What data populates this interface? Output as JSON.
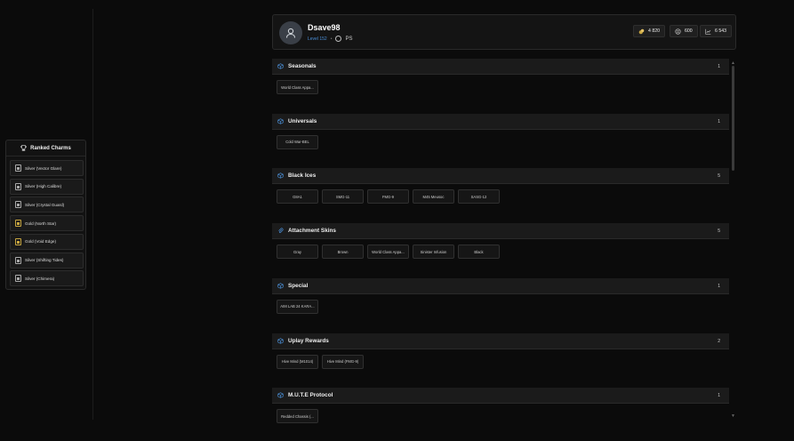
{
  "charms": {
    "title": "Ranked Charms",
    "items": [
      {
        "label": "Silver (Vector Glare)",
        "tier": "silver"
      },
      {
        "label": "Silver (High Calibre)",
        "tier": "silver"
      },
      {
        "label": "Silver (Crystal Guard)",
        "tier": "silver"
      },
      {
        "label": "Gold (North Star)",
        "tier": "gold"
      },
      {
        "label": "Gold (Void Edge)",
        "tier": "gold"
      },
      {
        "label": "Silver (Shifting Tides)",
        "tier": "silver"
      },
      {
        "label": "Silver (Chimera)",
        "tier": "silver"
      }
    ]
  },
  "profile": {
    "username": "Dsave98",
    "level": "Level 152",
    "separator": "•",
    "platform": "PS",
    "stats": [
      {
        "icon": "gold-coin-icon",
        "value": "4 820"
      },
      {
        "icon": "silver-coin-icon",
        "value": "600"
      },
      {
        "icon": "chart-icon",
        "value": "6 543"
      }
    ]
  },
  "sections": [
    {
      "title": "Seasonals",
      "count": "1",
      "items": [
        "World Class Appa..."
      ]
    },
    {
      "title": "Universals",
      "count": "1",
      "items": [
        "Cold War-BEL"
      ]
    },
    {
      "title": "Black Ices",
      "count": "5",
      "items": [
        "G8A1",
        "SMG-11",
        "FMG-9",
        "M45 Meusoc",
        "SASG-12"
      ]
    },
    {
      "title": "Attachment Skins",
      "count": "5",
      "items": [
        "Gray",
        "Brown",
        "World Class Appa...",
        "Sinister Infusion",
        "Black"
      ]
    },
    {
      "title": "Special",
      "count": "1",
      "items": [
        "AIM LAB 24 KARA..."
      ]
    },
    {
      "title": "Uplay Rewards",
      "count": "2",
      "items": [
        "Hive Mind (M1014)",
        "Hive Mind (FMG-9)"
      ]
    },
    {
      "title": "M.U.T.E Protocol",
      "count": "1",
      "items": [
        "Redded Chassis (..."
      ]
    }
  ],
  "colors": {
    "accent": "#4a8fd8",
    "gold": "#c8a640",
    "background": "#0b0b0b"
  }
}
